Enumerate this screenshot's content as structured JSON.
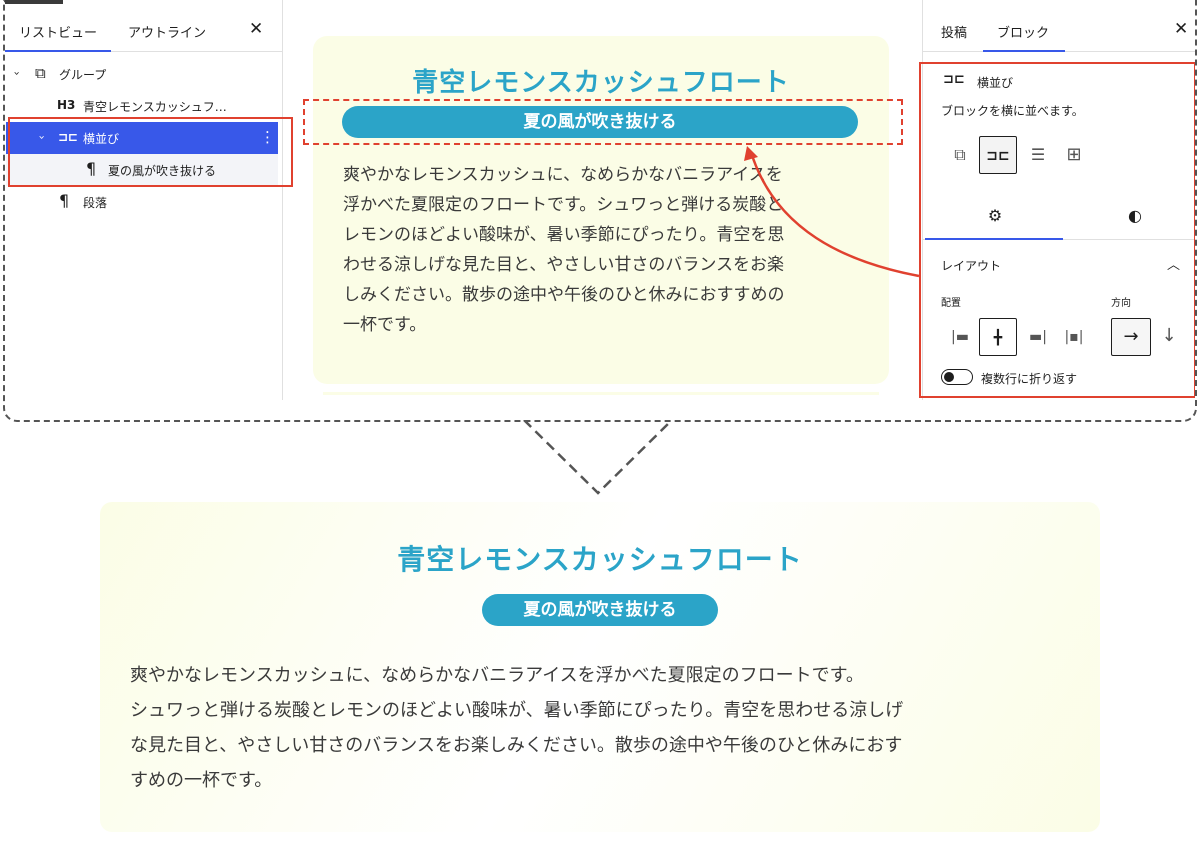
{
  "list_view": {
    "tabs": [
      "リストビュー",
      "アウトライン"
    ],
    "close": "✕",
    "items": [
      {
        "icon": "⧉",
        "chevron": "›",
        "label": "グループ"
      },
      {
        "tag": "H3",
        "label": "青空レモンスカッシュフ…"
      },
      {
        "icon": "⊐⊏",
        "chevron": "›",
        "label": "横並び",
        "more": "⋮"
      },
      {
        "icon": "¶",
        "label": "夏の風が吹き抜ける"
      },
      {
        "icon": "¶",
        "label": "段落"
      }
    ]
  },
  "canvas": {
    "title": "青空レモンスカッシュフロート",
    "pill": "夏の風が吹き抜ける",
    "paragraph_lines": [
      "爽やかなレモンスカッシュに、なめらかなバニラアイスを",
      "浮かべた夏限定のフロートです。シュワっと弾ける炭酸と",
      "レモンのほどよい酸味が、暑い季節にぴったり。青空を思",
      "わせる涼しげな見た目と、やさしい甘さのバランスをお楽",
      "しみください。散歩の途中や午後のひと休みにおすすめの",
      "一杯です。"
    ]
  },
  "settings": {
    "tabs": [
      "投稿",
      "ブロック"
    ],
    "close": "✕",
    "block_icon": "⊐⊏",
    "block_name": "横並び",
    "block_desc": "ブロックを横に並べます。",
    "variations": [
      "⧉",
      "⊐⊏",
      "☰",
      "⊞"
    ],
    "subtab_icons": [
      "⚙",
      "◐"
    ],
    "layout_label": "レイアウト",
    "chevron_up": "︿",
    "align_label": "配置",
    "direction_label": "方向",
    "align_icons": [
      "|▬",
      "╋",
      "▬|",
      "|▪|"
    ],
    "direction_icons": [
      "→",
      "↓"
    ],
    "wrap_label": "複数行に折り返す"
  },
  "result": {
    "title": "青空レモンスカッシュフロート",
    "pill": "夏の風が吹き抜ける",
    "paragraph_lines": [
      "爽やかなレモンスカッシュに、なめらかなバニラアイスを浮かべた夏限定のフロートです。",
      "シュワっと弾ける炭酸とレモンのほどよい酸味が、暑い季節にぴったり。青空を思わせる涼しげ",
      "な見た目と、やさしい甘さのバランスをお楽しみください。散歩の途中や午後のひと休みにおす",
      "すめの一杯です。"
    ]
  },
  "colors": {
    "accent": "#2ba4c8",
    "wp_blue": "#3858e9",
    "highlight_red": "#e0412f",
    "card_bg": "#fbfde6"
  }
}
